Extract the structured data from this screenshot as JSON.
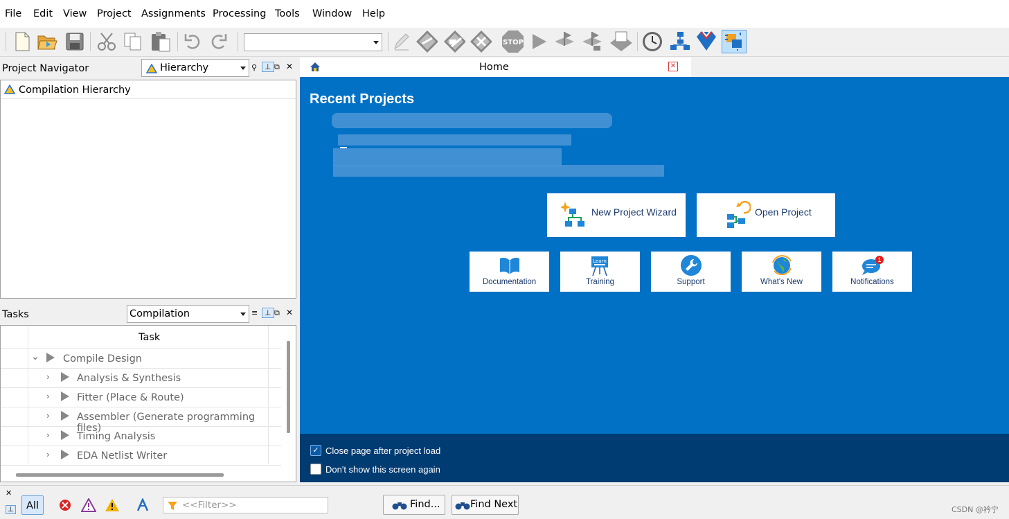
{
  "menu": [
    "File",
    "Edit",
    "View",
    "Project",
    "Assignments",
    "Processing",
    "Tools",
    "Window",
    "Help"
  ],
  "toolbar": {
    "revision_value": "",
    "icons": [
      "new-file-icon",
      "open-folder-icon",
      "save-icon",
      "cut-icon",
      "copy-icon",
      "paste-icon",
      "undo-icon",
      "redo-icon",
      "pencil-icon",
      "analysis-icon",
      "synthesis-icon",
      "fitter-icon",
      "stop-icon",
      "play-icon",
      "compile-flag-icon",
      "compile-flag2-icon",
      "programmer-icon",
      "timing-clock-icon",
      "netlist-icon",
      "chip-planner-icon",
      "pin-planner-icon"
    ]
  },
  "navigator": {
    "title": "Project Navigator",
    "dropdown_value": "Hierarchy",
    "item": "Compilation Hierarchy"
  },
  "tasks": {
    "title": "Tasks",
    "dropdown_value": "Compilation",
    "column_header": "Task",
    "rows": [
      {
        "label": "Compile Design",
        "level": 0,
        "expanded": true
      },
      {
        "label": "Analysis & Synthesis",
        "level": 1,
        "expanded": false
      },
      {
        "label": "Fitter (Place & Route)",
        "level": 1,
        "expanded": false
      },
      {
        "label": "Assembler (Generate programming files)",
        "level": 1,
        "expanded": false
      },
      {
        "label": "Timing Analysis",
        "level": 1,
        "expanded": false
      },
      {
        "label": "EDA Netlist Writer",
        "level": 1,
        "expanded": false
      }
    ]
  },
  "home": {
    "tab_label": "Home",
    "recent_title": "Recent Projects",
    "big_cards": [
      {
        "label": "New Project Wizard",
        "icon": "new-project-wizard-icon"
      },
      {
        "label": "Open Project",
        "icon": "open-project-icon"
      }
    ],
    "small_cards": [
      {
        "label": "Documentation",
        "icon": "book-icon"
      },
      {
        "label": "Training",
        "icon": "training-board-icon",
        "icon_text": "Learn"
      },
      {
        "label": "Support",
        "icon": "wrench-icon"
      },
      {
        "label": "What's New",
        "icon": "globe-icon"
      },
      {
        "label": "Notifications",
        "icon": "chat-bubble-icon",
        "badge": "1"
      }
    ],
    "footer": {
      "close_page_label": "Close page after project load",
      "close_page_checked": true,
      "dont_show_label": "Don't show this screen again",
      "dont_show_checked": false
    }
  },
  "bottom": {
    "all_label": "All",
    "filter_placeholder": "<<Filter>>",
    "find_label": "Find...",
    "find_next_label": "Find Next"
  },
  "watermark": "CSDN @衿宁",
  "colors": {
    "home_blue": "#0071c5",
    "footer_navy": "#003b72",
    "card_text": "#1a3a6e"
  }
}
